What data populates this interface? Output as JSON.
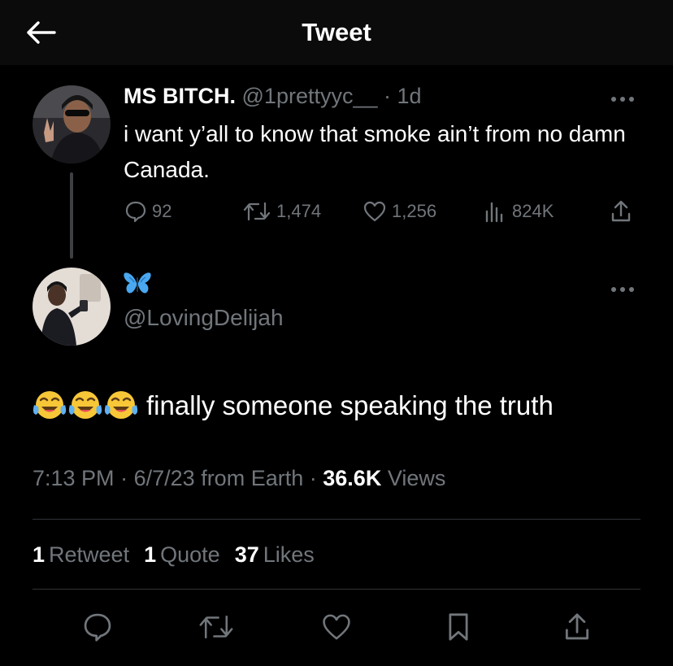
{
  "header": {
    "title": "Tweet",
    "back_icon": "arrow-left-icon"
  },
  "parent_tweet": {
    "author_name": "MS BITCH.",
    "author_handle": "@1prettyyc__",
    "separator": "·",
    "time_ago": "1d",
    "text": "i want y’all to know that smoke ain’t from no damn Canada.",
    "replies": "92",
    "retweets": "1,474",
    "likes": "1,256",
    "views": "824K"
  },
  "main_tweet": {
    "display_name_icon": "blue-butterfly-emoji",
    "author_handle": "@LovingDelijah",
    "emoji": "😂😂😂",
    "text": "finally someone speaking the truth",
    "time": "7:13 PM",
    "separator1": "·",
    "date": "6/7/23",
    "source": "from Earth",
    "separator2": "·",
    "views_count": "36.6K",
    "views_label": "Views"
  },
  "stats": {
    "retweets_count": "1",
    "retweets_label": "Retweet",
    "quotes_count": "1",
    "quotes_label": "Quote",
    "likes_count": "37",
    "likes_label": "Likes"
  },
  "colors": {
    "background": "#000000",
    "header_bg": "#0b0b0c",
    "text_primary": "#e7e9ea",
    "text_secondary": "#71767b",
    "divider": "#2f3336",
    "butterfly": "#4aa8f0"
  }
}
